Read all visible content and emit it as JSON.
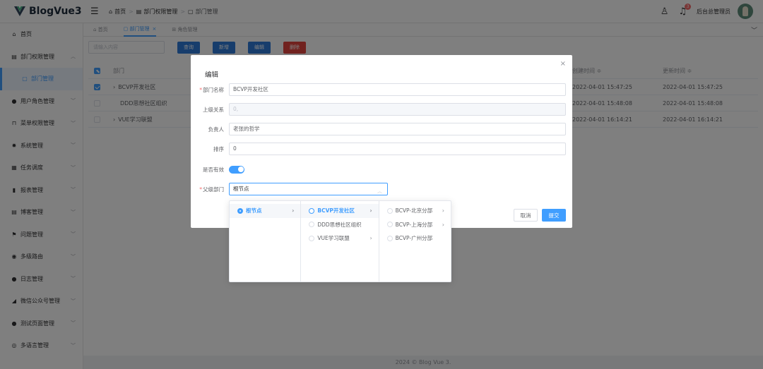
{
  "app": {
    "title": "BlogVue3",
    "brand_color": "#409eff"
  },
  "header": {
    "breadcrumb": [
      "首页",
      "部门权限管理",
      "部门管理"
    ],
    "notification_count": "3",
    "username": "后台总管理员"
  },
  "sidebar": {
    "items": [
      {
        "label": "首页",
        "icon": "home-icon"
      },
      {
        "label": "部门权限管理",
        "icon": "briefcase-icon",
        "expanded": true
      },
      {
        "label": "部门管理",
        "icon": "document-icon",
        "active": true
      },
      {
        "label": "用户角色管理",
        "icon": "user-icon"
      },
      {
        "label": "菜单权限管理",
        "icon": "lock-icon"
      },
      {
        "label": "系统管理",
        "icon": "gear-icon"
      },
      {
        "label": "任务调度",
        "icon": "task-icon"
      },
      {
        "label": "报表管理",
        "icon": "bar-chart-icon"
      },
      {
        "label": "博客管理",
        "icon": "blog-icon"
      },
      {
        "label": "问题管理",
        "icon": "flag-icon"
      },
      {
        "label": "多级路由",
        "icon": "route-icon"
      },
      {
        "label": "日志管理",
        "icon": "user-log-icon"
      },
      {
        "label": "微信公众号管理",
        "icon": "wechat-icon"
      },
      {
        "label": "测试页面管理",
        "icon": "info-icon"
      },
      {
        "label": "多语言管理",
        "icon": "globe-icon"
      }
    ]
  },
  "tabs": [
    {
      "label": "首页",
      "icon": "home-icon"
    },
    {
      "label": "部门管理",
      "icon": "document-icon",
      "active": true
    },
    {
      "label": "角色管理",
      "icon": "grid-icon"
    }
  ],
  "toolbar": {
    "search_placeholder": "请输入内容",
    "query_label": "查询",
    "add_label": "新增",
    "edit_label": "编辑",
    "delete_label": "删除"
  },
  "table": {
    "headers": {
      "name": "部门",
      "created": "创建时间 ≑",
      "updated": "更新时间 ≑"
    },
    "rows": [
      {
        "name": "BCVP开发社区",
        "created": "2022-04-01 15:47:25",
        "updated": "2022-04-01 15:47:25",
        "checked": true,
        "expand": true
      },
      {
        "name": "DDD思想社区组织",
        "created": "2022-04-01 15:48:08",
        "updated": "2022-04-01 15:48:08",
        "checked": false,
        "expand": false
      },
      {
        "name": "VUE学习联盟",
        "created": "2022-04-01 16:14:21",
        "updated": "2022-04-01 16:14:21",
        "checked": false,
        "expand": true
      }
    ]
  },
  "dialog": {
    "title": "编辑",
    "fields": {
      "name": {
        "label": "部门名称",
        "value": "BCVP开发社区"
      },
      "parent_relation": {
        "label": "上级关系",
        "value": "0,"
      },
      "leader": {
        "label": "负责人",
        "value": "老张的哲学"
      },
      "order": {
        "label": "排序",
        "value": "0"
      },
      "enabled": {
        "label": "是否有效",
        "value": true
      },
      "parent_dept": {
        "label": "父级部门",
        "value": "根节点"
      }
    },
    "cancel_label": "取消",
    "submit_label": "提交"
  },
  "cascader": {
    "col1": [
      {
        "label": "根节点",
        "selected": true
      }
    ],
    "col2": [
      {
        "label": "BCVP开发社区",
        "active": true,
        "has_children": true
      },
      {
        "label": "DDD思想社区组织",
        "has_children": false
      },
      {
        "label": "VUE学习联盟",
        "has_children": true
      }
    ],
    "col3": [
      {
        "label": "BCVP-北京分部",
        "has_children": true
      },
      {
        "label": "BCVP-上海分部",
        "has_children": true
      },
      {
        "label": "BCVP-广州分部",
        "has_children": false
      }
    ]
  },
  "footer": {
    "text": "2024 © Blog Vue 3."
  }
}
